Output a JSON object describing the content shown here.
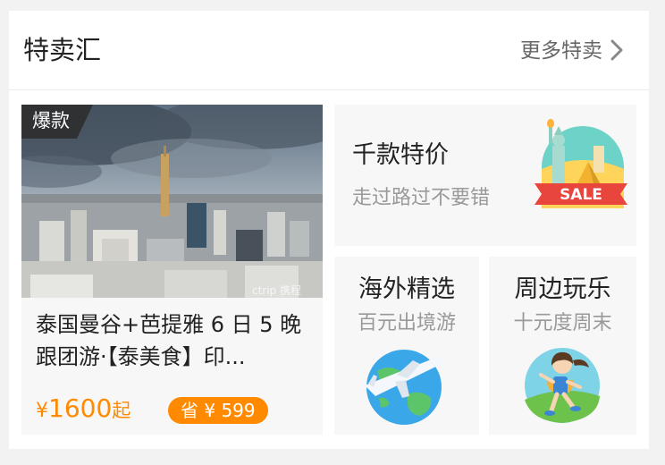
{
  "header": {
    "title": "特卖汇",
    "more_label": "更多特卖"
  },
  "deal": {
    "badge": "爆款",
    "title": "泰国曼谷+芭提雅 6 日 5 晚跟团游·【泰美食】印...",
    "currency": "¥",
    "price": "1600",
    "price_suffix": "起",
    "save_label": "省 ¥ 599",
    "image_watermark": "ctrip 携程"
  },
  "tiles": [
    {
      "title": "千款特价",
      "subtitle": "走过路过不要错",
      "icon": "statue-of-liberty-sale-icon",
      "banner_text": "SALE"
    },
    {
      "title": "海外精选",
      "subtitle": "百元出境游",
      "icon": "airplane-globe-icon"
    },
    {
      "title": "周边玩乐",
      "subtitle": "十元度周末",
      "icon": "girl-running-icon"
    }
  ],
  "colors": {
    "accent": "#ff8a00",
    "badge_bg": "#2b2b2b",
    "sale_ribbon": "#e8453c"
  }
}
